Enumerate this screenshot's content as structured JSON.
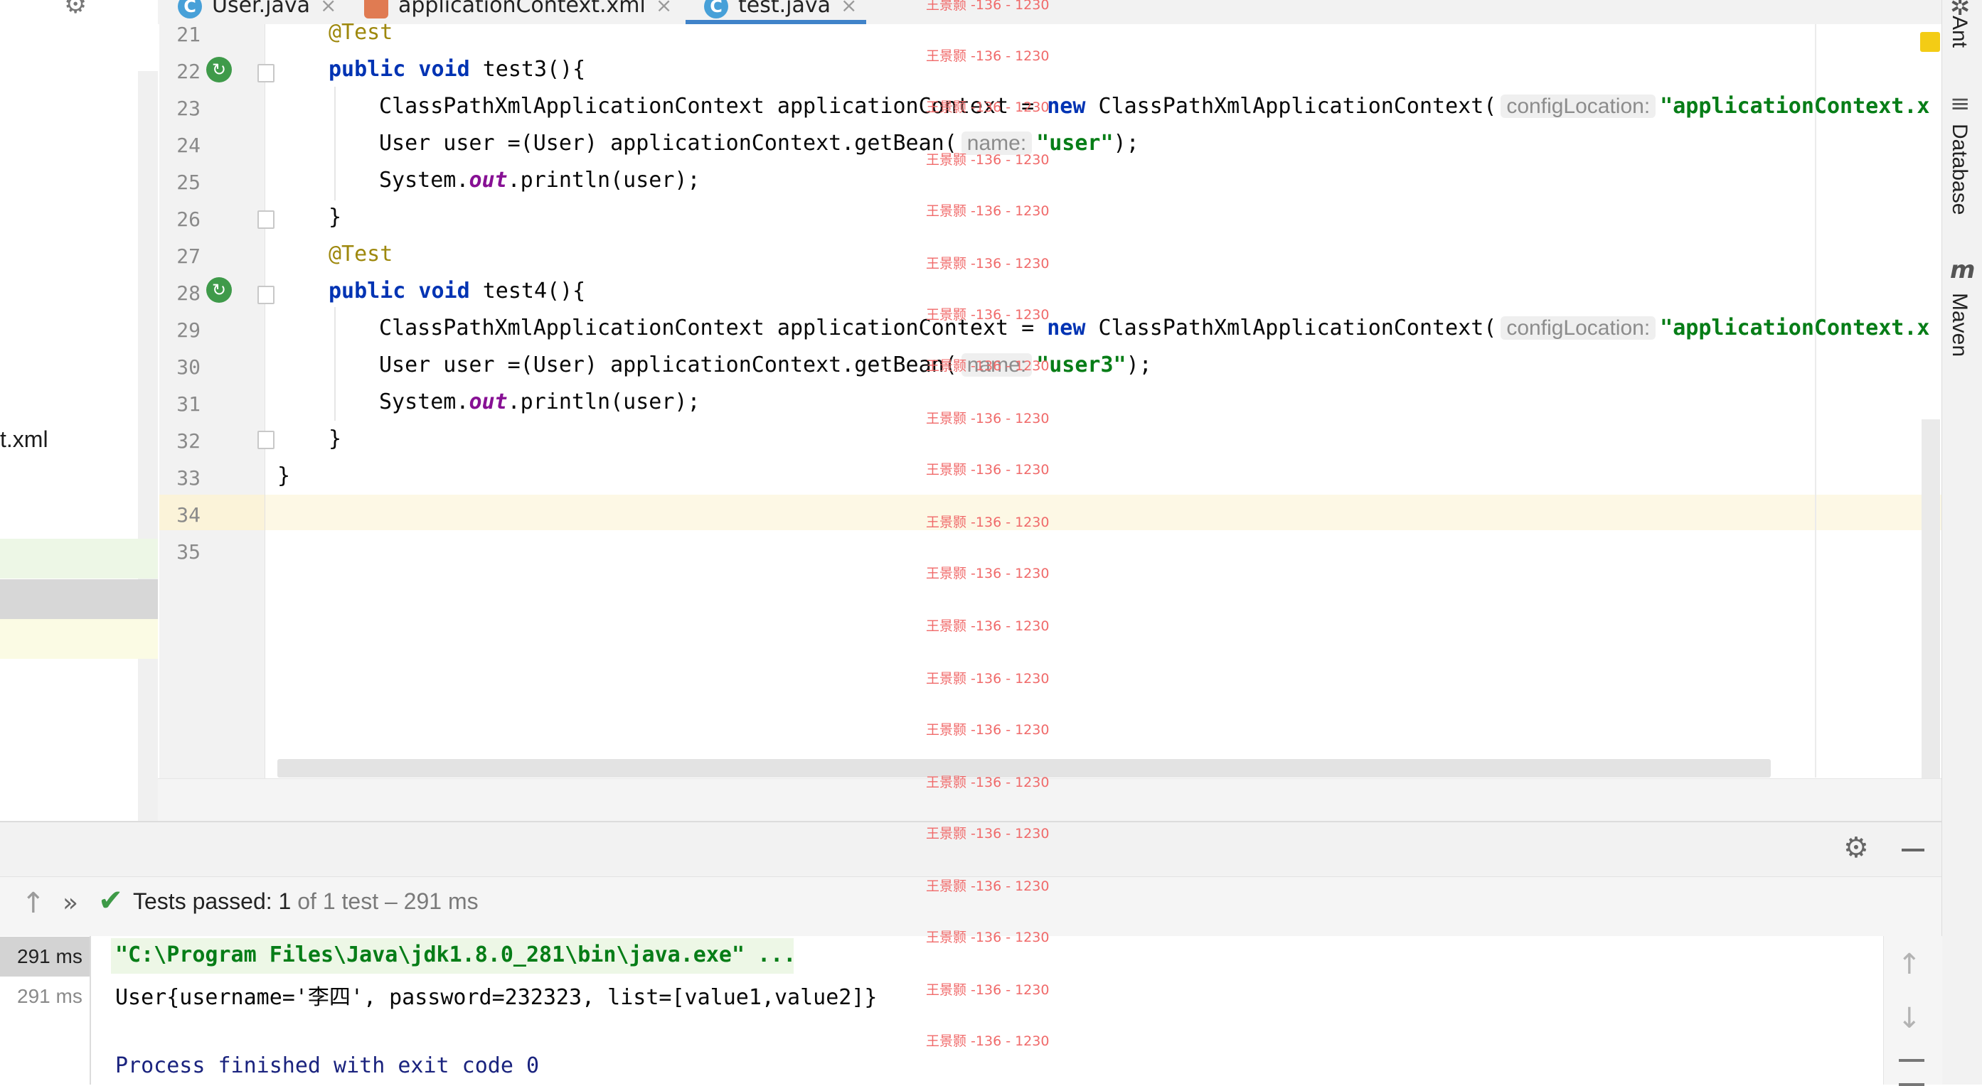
{
  "tabs": [
    {
      "label": "User.java",
      "icon": "C"
    },
    {
      "label": "applicationContext.xml",
      "icon": ""
    },
    {
      "label": "test.java",
      "icon": "C"
    }
  ],
  "tab_close_glyph": "×",
  "project_panel": {
    "partial_file": "t.xml"
  },
  "editor": {
    "line_numbers": [
      "21",
      "22",
      "23",
      "24",
      "25",
      "26",
      "27",
      "28",
      "29",
      "30",
      "31",
      "32",
      "33",
      "34",
      "35"
    ],
    "lines": {
      "l21_ann": "@Test",
      "l22_kw": "public void",
      "l22_rest": " test3(){",
      "l23_a": "ClassPathXmlApplicationContext applicationContext = ",
      "l23_kw": "new",
      "l23_b": " ClassPathXmlApplicationContext(",
      "l23_hint": "configLocation:",
      "l23_str": "\"applicationContext.x",
      "l24_a": "User user =(User) applicationContext.getBean(",
      "l24_hint": "name:",
      "l24_str": "\"user\"",
      "l24_end": ");",
      "l25_a": "System.",
      "l25_fld": "out",
      "l25_b": ".println(user);",
      "l26": "}",
      "l27_ann": "@Test",
      "l28_kw": "public void",
      "l28_rest": " test4(){",
      "l29_a": "ClassPathXmlApplicationContext applicationContext = ",
      "l29_kw": "new",
      "l29_b": " ClassPathXmlApplicationContext(",
      "l29_hint": "configLocation:",
      "l29_str": "\"applicationContext.x",
      "l30_a": "User user =(User) applicationContext.getBean(",
      "l30_hint": "name:",
      "l30_str": "\"user3\"",
      "l30_end": ");",
      "l31_a": "System.",
      "l31_fld": "out",
      "l31_b": ".println(user);",
      "l32": "}",
      "l33": "}"
    }
  },
  "watermark": "王景颢 -136 - 1230",
  "right_sidebar": {
    "ant": "Ant",
    "database": "Database",
    "maven": "Maven",
    "maven_glyph": "m"
  },
  "run": {
    "status_main": "Tests passed: 1",
    "status_rest": " of 1 test – 291 ms",
    "tree_times": [
      "291 ms",
      "291 ms"
    ],
    "console": {
      "cmd": "\"C:\\Program Files\\Java\\jdk1.8.0_281\\bin\\java.exe\" ...",
      "output": "User{username='李四', password=232323, list=[value1,value2]}",
      "exit": "Process finished with exit code 0"
    }
  },
  "colors": {
    "keyword": "#0033b3",
    "string": "#067d17",
    "annotation": "#9e880d",
    "field": "#871094",
    "pass": "#3e9a47",
    "watermark": "#f06a6a"
  }
}
